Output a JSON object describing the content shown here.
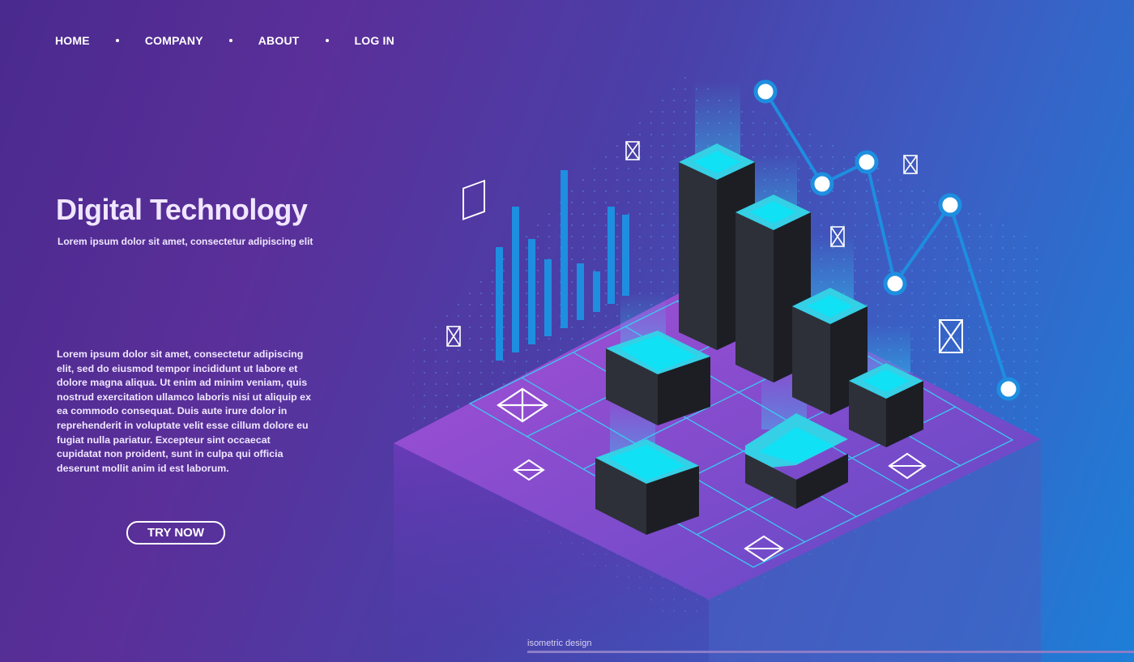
{
  "nav": {
    "items": [
      {
        "label": "HOME"
      },
      {
        "label": "COMPANY"
      },
      {
        "label": "ABOUT"
      },
      {
        "label": "LOG IN"
      }
    ]
  },
  "hero": {
    "title": "Digital Technology",
    "subtitle": "Lorem ipsum dolor sit amet, consectetur adipiscing elit",
    "body": "Lorem ipsum dolor sit amet, consectetur adipiscing elit, sed do eiusmod tempor incididunt ut labore et dolore magna aliqua. Ut enim ad minim veniam, quis nostrud exercitation ullamco laboris nisi ut aliquip ex ea commodo consequat. Duis aute irure dolor in reprehenderit in voluptate velit esse cillum dolore eu fugiat nulla pariatur. Excepteur sint occaecat cupidatat non proident, sunt in culpa qui officia deserunt mollit anim id est laborum.",
    "cta_label": "TRY NOW"
  },
  "footer": {
    "caption": "isometric design"
  },
  "colors": {
    "accent_cyan": "#22d9f0",
    "bar_blue": "#1e8ee0",
    "block_dark": "#2a2d36",
    "platform_purple": "#8a3fc8"
  },
  "icons": [
    "envelope-icon",
    "node-icon"
  ]
}
